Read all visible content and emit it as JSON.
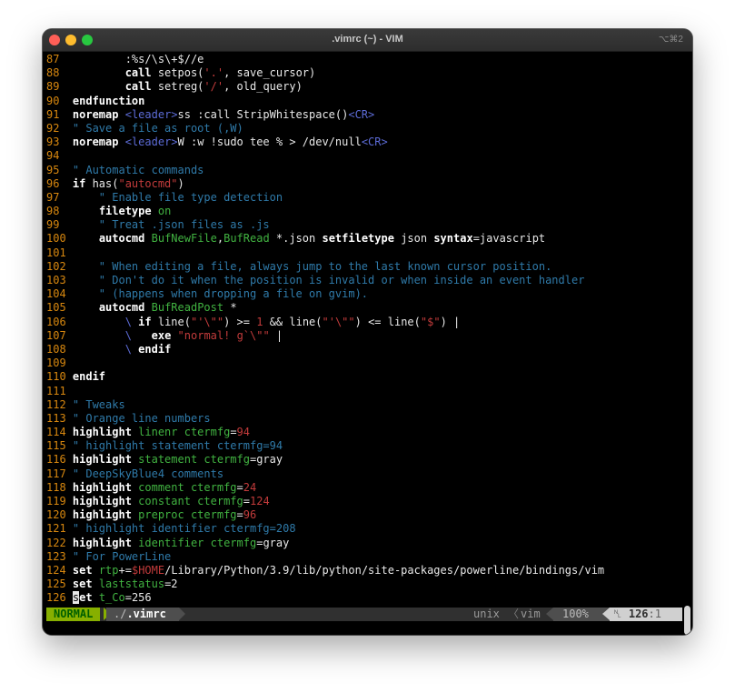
{
  "window": {
    "title": ".vimrc (~) - VIM",
    "shortcut": "⌥⌘2"
  },
  "statusline": {
    "mode": "NORMAL",
    "file_prefix": "./",
    "file_name": ".vimrc",
    "fileformat": "unix",
    "separator": "〈",
    "filetype": "vim",
    "percent": "100%",
    "line_icon": "␤",
    "line": "126",
    "column": ":1"
  },
  "colors": {
    "line_number": "#d7870f",
    "comment": "#2f7aa9",
    "string": "#c23b3b",
    "builtin": "#41b341",
    "special": "#5c6bd6",
    "mode_bg": "#87af00"
  },
  "lines": [
    {
      "num": "87",
      "segments": [
        {
          "t": "        :%s/\\s\\+$//e",
          "c": "plain"
        }
      ]
    },
    {
      "num": "88",
      "segments": [
        {
          "t": "        ",
          "c": "plain"
        },
        {
          "t": "call",
          "c": "k"
        },
        {
          "t": " setpos(",
          "c": "plain"
        },
        {
          "t": "'.'",
          "c": "s"
        },
        {
          "t": ", save_cursor)",
          "c": "plain"
        }
      ]
    },
    {
      "num": "89",
      "segments": [
        {
          "t": "        ",
          "c": "plain"
        },
        {
          "t": "call",
          "c": "k"
        },
        {
          "t": " setreg(",
          "c": "plain"
        },
        {
          "t": "'/'",
          "c": "s"
        },
        {
          "t": ", old_query)",
          "c": "plain"
        }
      ]
    },
    {
      "num": "90",
      "segments": [
        {
          "t": "endfunction",
          "c": "k"
        }
      ]
    },
    {
      "num": "91",
      "segments": [
        {
          "t": "noremap",
          "c": "k"
        },
        {
          "t": " ",
          "c": "plain"
        },
        {
          "t": "<leader>",
          "c": "b"
        },
        {
          "t": "ss :call StripWhitespace()",
          "c": "plain"
        },
        {
          "t": "<CR>",
          "c": "b"
        }
      ]
    },
    {
      "num": "92",
      "segments": [
        {
          "t": "\" Save a file as root (,W)",
          "c": "c"
        }
      ]
    },
    {
      "num": "93",
      "segments": [
        {
          "t": "noremap",
          "c": "k"
        },
        {
          "t": " ",
          "c": "plain"
        },
        {
          "t": "<leader>",
          "c": "b"
        },
        {
          "t": "W :w !sudo tee % > /dev/null",
          "c": "plain"
        },
        {
          "t": "<CR>",
          "c": "b"
        }
      ]
    },
    {
      "num": "94",
      "segments": []
    },
    {
      "num": "95",
      "segments": [
        {
          "t": "\" Automatic commands",
          "c": "c"
        }
      ]
    },
    {
      "num": "96",
      "segments": [
        {
          "t": "if",
          "c": "k"
        },
        {
          "t": " has(",
          "c": "plain"
        },
        {
          "t": "\"autocmd\"",
          "c": "s"
        },
        {
          "t": ")",
          "c": "plain"
        }
      ]
    },
    {
      "num": "97",
      "segments": [
        {
          "t": "    \" Enable file type detection",
          "c": "c"
        }
      ]
    },
    {
      "num": "98",
      "segments": [
        {
          "t": "    ",
          "c": "plain"
        },
        {
          "t": "filetype",
          "c": "k"
        },
        {
          "t": " ",
          "c": "plain"
        },
        {
          "t": "on",
          "c": "g"
        }
      ]
    },
    {
      "num": "99",
      "segments": [
        {
          "t": "    \" Treat .json files as .js",
          "c": "c"
        }
      ]
    },
    {
      "num": "100",
      "segments": [
        {
          "t": "    ",
          "c": "plain"
        },
        {
          "t": "autocmd",
          "c": "k"
        },
        {
          "t": " ",
          "c": "plain"
        },
        {
          "t": "BufNewFile",
          "c": "g"
        },
        {
          "t": ",",
          "c": "plain"
        },
        {
          "t": "BufRead",
          "c": "g"
        },
        {
          "t": " *.json ",
          "c": "plain"
        },
        {
          "t": "setfiletype",
          "c": "k"
        },
        {
          "t": " json ",
          "c": "plain"
        },
        {
          "t": "syntax",
          "c": "k"
        },
        {
          "t": "=javascript",
          "c": "plain"
        }
      ]
    },
    {
      "num": "101",
      "segments": []
    },
    {
      "num": "102",
      "segments": [
        {
          "t": "    \" When editing a file, always jump to the last known cursor position.",
          "c": "c"
        }
      ]
    },
    {
      "num": "103",
      "segments": [
        {
          "t": "    \" Don't do it when the position is invalid or when inside an event handler",
          "c": "c"
        }
      ]
    },
    {
      "num": "104",
      "segments": [
        {
          "t": "    \" (happens when dropping a file on gvim).",
          "c": "c"
        }
      ]
    },
    {
      "num": "105",
      "segments": [
        {
          "t": "    ",
          "c": "plain"
        },
        {
          "t": "autocmd",
          "c": "k"
        },
        {
          "t": " ",
          "c": "plain"
        },
        {
          "t": "BufReadPost",
          "c": "g"
        },
        {
          "t": " *",
          "c": "plain"
        }
      ]
    },
    {
      "num": "106",
      "segments": [
        {
          "t": "        ",
          "c": "plain"
        },
        {
          "t": "\\",
          "c": "b"
        },
        {
          "t": " ",
          "c": "plain"
        },
        {
          "t": "if",
          "c": "k"
        },
        {
          "t": " line(",
          "c": "plain"
        },
        {
          "t": "\"'\\\"\"",
          "c": "s"
        },
        {
          "t": ") >= ",
          "c": "plain"
        },
        {
          "t": "1",
          "c": "n"
        },
        {
          "t": " && line(",
          "c": "plain"
        },
        {
          "t": "\"'\\\"\"",
          "c": "s"
        },
        {
          "t": ") <= line(",
          "c": "plain"
        },
        {
          "t": "\"$\"",
          "c": "s"
        },
        {
          "t": ") |",
          "c": "plain"
        }
      ]
    },
    {
      "num": "107",
      "segments": [
        {
          "t": "        ",
          "c": "plain"
        },
        {
          "t": "\\",
          "c": "b"
        },
        {
          "t": "   ",
          "c": "plain"
        },
        {
          "t": "exe",
          "c": "k"
        },
        {
          "t": " ",
          "c": "plain"
        },
        {
          "t": "\"normal! g`\\\"\"",
          "c": "s"
        },
        {
          "t": " |",
          "c": "plain"
        }
      ]
    },
    {
      "num": "108",
      "segments": [
        {
          "t": "        ",
          "c": "plain"
        },
        {
          "t": "\\",
          "c": "b"
        },
        {
          "t": " ",
          "c": "plain"
        },
        {
          "t": "endif",
          "c": "k"
        }
      ]
    },
    {
      "num": "109",
      "segments": []
    },
    {
      "num": "110",
      "segments": [
        {
          "t": "endif",
          "c": "k"
        }
      ]
    },
    {
      "num": "111",
      "segments": []
    },
    {
      "num": "112",
      "segments": [
        {
          "t": "\" Tweaks",
          "c": "c"
        }
      ]
    },
    {
      "num": "113",
      "segments": [
        {
          "t": "\" Orange line numbers",
          "c": "c"
        }
      ]
    },
    {
      "num": "114",
      "segments": [
        {
          "t": "highlight",
          "c": "k"
        },
        {
          "t": " linenr ctermfg",
          "c": "g"
        },
        {
          "t": "=",
          "c": "plain"
        },
        {
          "t": "94",
          "c": "n"
        }
      ]
    },
    {
      "num": "115",
      "segments": [
        {
          "t": "\" highlight statement ctermfg=94",
          "c": "c"
        }
      ]
    },
    {
      "num": "116",
      "segments": [
        {
          "t": "highlight",
          "c": "k"
        },
        {
          "t": " statement ctermfg",
          "c": "g"
        },
        {
          "t": "=gray",
          "c": "plain"
        }
      ]
    },
    {
      "num": "117",
      "segments": [
        {
          "t": "\" DeepSkyBlue4 comments",
          "c": "c"
        }
      ]
    },
    {
      "num": "118",
      "segments": [
        {
          "t": "highlight",
          "c": "k"
        },
        {
          "t": " comment ctermfg",
          "c": "g"
        },
        {
          "t": "=",
          "c": "plain"
        },
        {
          "t": "24",
          "c": "n"
        }
      ]
    },
    {
      "num": "119",
      "segments": [
        {
          "t": "highlight",
          "c": "k"
        },
        {
          "t": " constant ctermfg",
          "c": "g"
        },
        {
          "t": "=",
          "c": "plain"
        },
        {
          "t": "124",
          "c": "n"
        }
      ]
    },
    {
      "num": "120",
      "segments": [
        {
          "t": "highlight",
          "c": "k"
        },
        {
          "t": " preproc ctermfg",
          "c": "g"
        },
        {
          "t": "=",
          "c": "plain"
        },
        {
          "t": "96",
          "c": "n"
        }
      ]
    },
    {
      "num": "121",
      "segments": [
        {
          "t": "\" highlight identifier ctermfg=208",
          "c": "c"
        }
      ]
    },
    {
      "num": "122",
      "segments": [
        {
          "t": "highlight",
          "c": "k"
        },
        {
          "t": " identifier ctermfg",
          "c": "g"
        },
        {
          "t": "=gray",
          "c": "plain"
        }
      ]
    },
    {
      "num": "123",
      "segments": [
        {
          "t": "\" For PowerLine",
          "c": "c"
        }
      ]
    },
    {
      "num": "124",
      "segments": [
        {
          "t": "set",
          "c": "k"
        },
        {
          "t": " ",
          "c": "plain"
        },
        {
          "t": "rtp",
          "c": "g"
        },
        {
          "t": "+=",
          "c": "plain"
        },
        {
          "t": "$HOME",
          "c": "n"
        },
        {
          "t": "/Library/Python/3.9/lib/python/site-packages/powerline/bindings/vim",
          "c": "plain"
        }
      ]
    },
    {
      "num": "125",
      "segments": [
        {
          "t": "set",
          "c": "k"
        },
        {
          "t": " ",
          "c": "plain"
        },
        {
          "t": "laststatus",
          "c": "g"
        },
        {
          "t": "=2",
          "c": "plain"
        }
      ]
    },
    {
      "num": "126",
      "segments": [
        {
          "t": "s",
          "c": "cursor"
        },
        {
          "t": "et",
          "c": "k"
        },
        {
          "t": " ",
          "c": "plain"
        },
        {
          "t": "t_Co",
          "c": "g"
        },
        {
          "t": "=256",
          "c": "plain"
        }
      ]
    }
  ]
}
